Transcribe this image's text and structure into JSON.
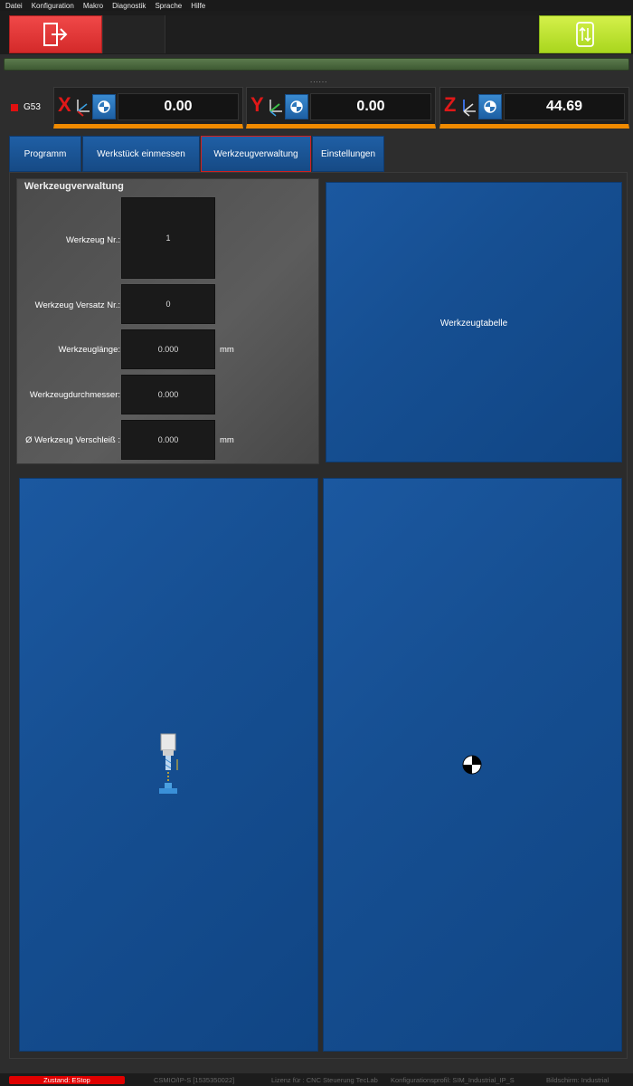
{
  "menu": [
    "Datei",
    "Konfiguration",
    "Makro",
    "Diagnostik",
    "Sprache",
    "Hilfe"
  ],
  "toolbar": {
    "exit_icon": "exit-icon",
    "switch_icon": "swap-vertical-icon",
    "progress_dots": "......"
  },
  "coord_system": "G53",
  "axes": [
    {
      "letter": "X",
      "value": "0.00"
    },
    {
      "letter": "Y",
      "value": "0.00"
    },
    {
      "letter": "Z",
      "value": "44.69"
    }
  ],
  "tabs": [
    "Programm",
    "Werkstück einmessen",
    "Werkzeugverwaltung",
    "Einstellungen"
  ],
  "active_tab": "Werkzeugverwaltung",
  "tool_panel": {
    "title": "Werkzeugverwaltung",
    "fields": [
      {
        "label": "Werkzeug Nr.:",
        "value": "1",
        "unit": ""
      },
      {
        "label": "Werkzeug Versatz Nr.:",
        "value": "0",
        "unit": ""
      },
      {
        "label": "Werkzeuglänge:",
        "value": "0.000",
        "unit": "mm"
      },
      {
        "label": "Werkzeugdurchmesser:",
        "value": "0.000",
        "unit": ""
      },
      {
        "label": "Ø Werkzeug Verschleiß :",
        "value": "0.000",
        "unit": "mm"
      }
    ]
  },
  "tool_table_label": "Werkzeugtabelle",
  "status": {
    "state": "Zustand: EStop",
    "items": [
      "CSMIO/IP-S [1535350022]",
      "Lizenz für : CNC Steuerung TecLab",
      "Konfigurationsprofil: SIM_Industrial_IP_S",
      "Bildschirm: Industrial"
    ]
  },
  "colors": {
    "estop": "#e00000",
    "accent_orange": "#f08a00",
    "panel_blue": "#164f92",
    "exit_red": "#e03a3a",
    "switch_green": "#b8e02a"
  }
}
